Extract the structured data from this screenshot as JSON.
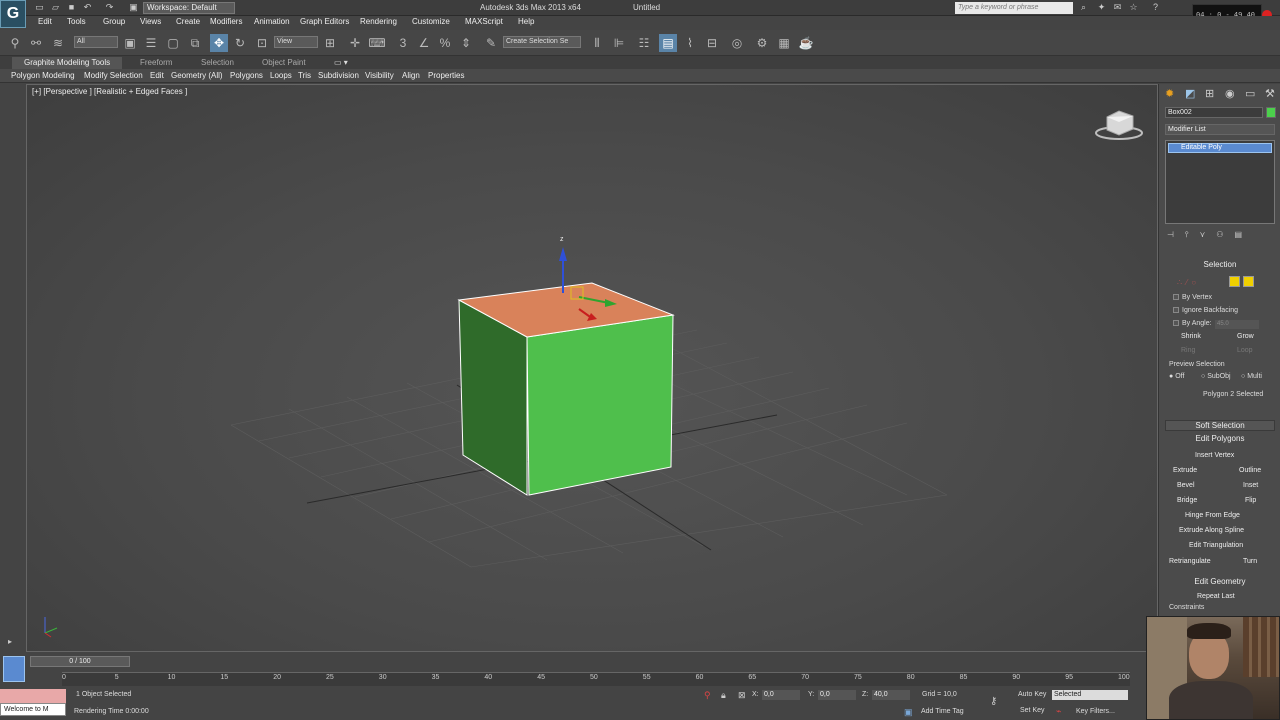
{
  "app": {
    "title": "Autodesk 3ds Max  2013 x64",
    "document": "Untitled",
    "workspace": "Workspace: Default",
    "search_placeholder": "Type a keyword or phrase"
  },
  "menu": [
    "Edit",
    "Tools",
    "Group",
    "Views",
    "Create",
    "Modifiers",
    "Animation",
    "Graph Editors",
    "Rendering",
    "Customize",
    "MAXScript",
    "Help"
  ],
  "toolbar": {
    "filter": "All",
    "view": "View",
    "selection_set": "Create Selection Se"
  },
  "ribbon": {
    "tabs": [
      "Graphite Modeling Tools",
      "Freeform",
      "Selection",
      "Object Paint"
    ],
    "items": [
      "Polygon Modeling",
      "Modify Selection",
      "Edit",
      "Geometry (All)",
      "Polygons",
      "Loops",
      "Tris",
      "Subdivision",
      "Visibility",
      "Align",
      "Properties"
    ]
  },
  "viewport": {
    "label": "[+] [Perspective ] [Realistic + Edged Faces ]",
    "gizmo_z": "z"
  },
  "command_panel": {
    "object_name": "Box002",
    "object_color": "#4cd04c",
    "modifier_list": "Modifier List",
    "stack_item": "Editable Poly",
    "selection": {
      "title": "Selection",
      "by_vertex": "By Vertex",
      "ignore_backfacing": "Ignore Backfacing",
      "by_angle": "By Angle:",
      "angle_value": "45.0",
      "shrink": "Shrink",
      "grow": "Grow",
      "ring": "Ring",
      "loop": "Loop",
      "preview_title": "Preview Selection",
      "preview_options": [
        "Off",
        "SubObj",
        "Multi"
      ],
      "status": "Polygon 2 Selected"
    },
    "soft_selection": "Soft Selection",
    "edit_polygons": {
      "title": "Edit Polygons",
      "insert_vertex": "Insert Vertex",
      "extrude": "Extrude",
      "outline": "Outline",
      "bevel": "Bevel",
      "inset": "Inset",
      "bridge": "Bridge",
      "flip": "Flip",
      "hinge": "Hinge From Edge",
      "extrude_spline": "Extrude Along Spline",
      "edit_tri": "Edit Triangulation",
      "retriangulate": "Retriangulate",
      "turn": "Turn"
    },
    "edit_geometry": {
      "title": "Edit Geometry",
      "repeat_last": "Repeat Last",
      "constraints": "Constraints"
    }
  },
  "timeline": {
    "frame": "0 / 100",
    "ticks": [
      "0",
      "5",
      "10",
      "15",
      "20",
      "25",
      "30",
      "35",
      "40",
      "45",
      "50",
      "55",
      "60",
      "65",
      "70",
      "75",
      "80",
      "85",
      "90",
      "95",
      "100"
    ]
  },
  "status": {
    "welcome": "Welcome to M",
    "selected": "1 Object Selected",
    "render_time": "Rendering Time  0:00:00",
    "x_label": "X:",
    "x_value": "0,0",
    "y_label": "Y:",
    "y_value": "0,0",
    "z_label": "Z:",
    "z_value": "40,0",
    "grid": "Grid = 10,0",
    "add_time_tag": "Add Time Tag",
    "auto_key": "Auto Key",
    "set_key": "Set Key",
    "key_mode": "Selected",
    "key_filters": "Key Filters..."
  },
  "clock": "04 : 0 - 49 40"
}
